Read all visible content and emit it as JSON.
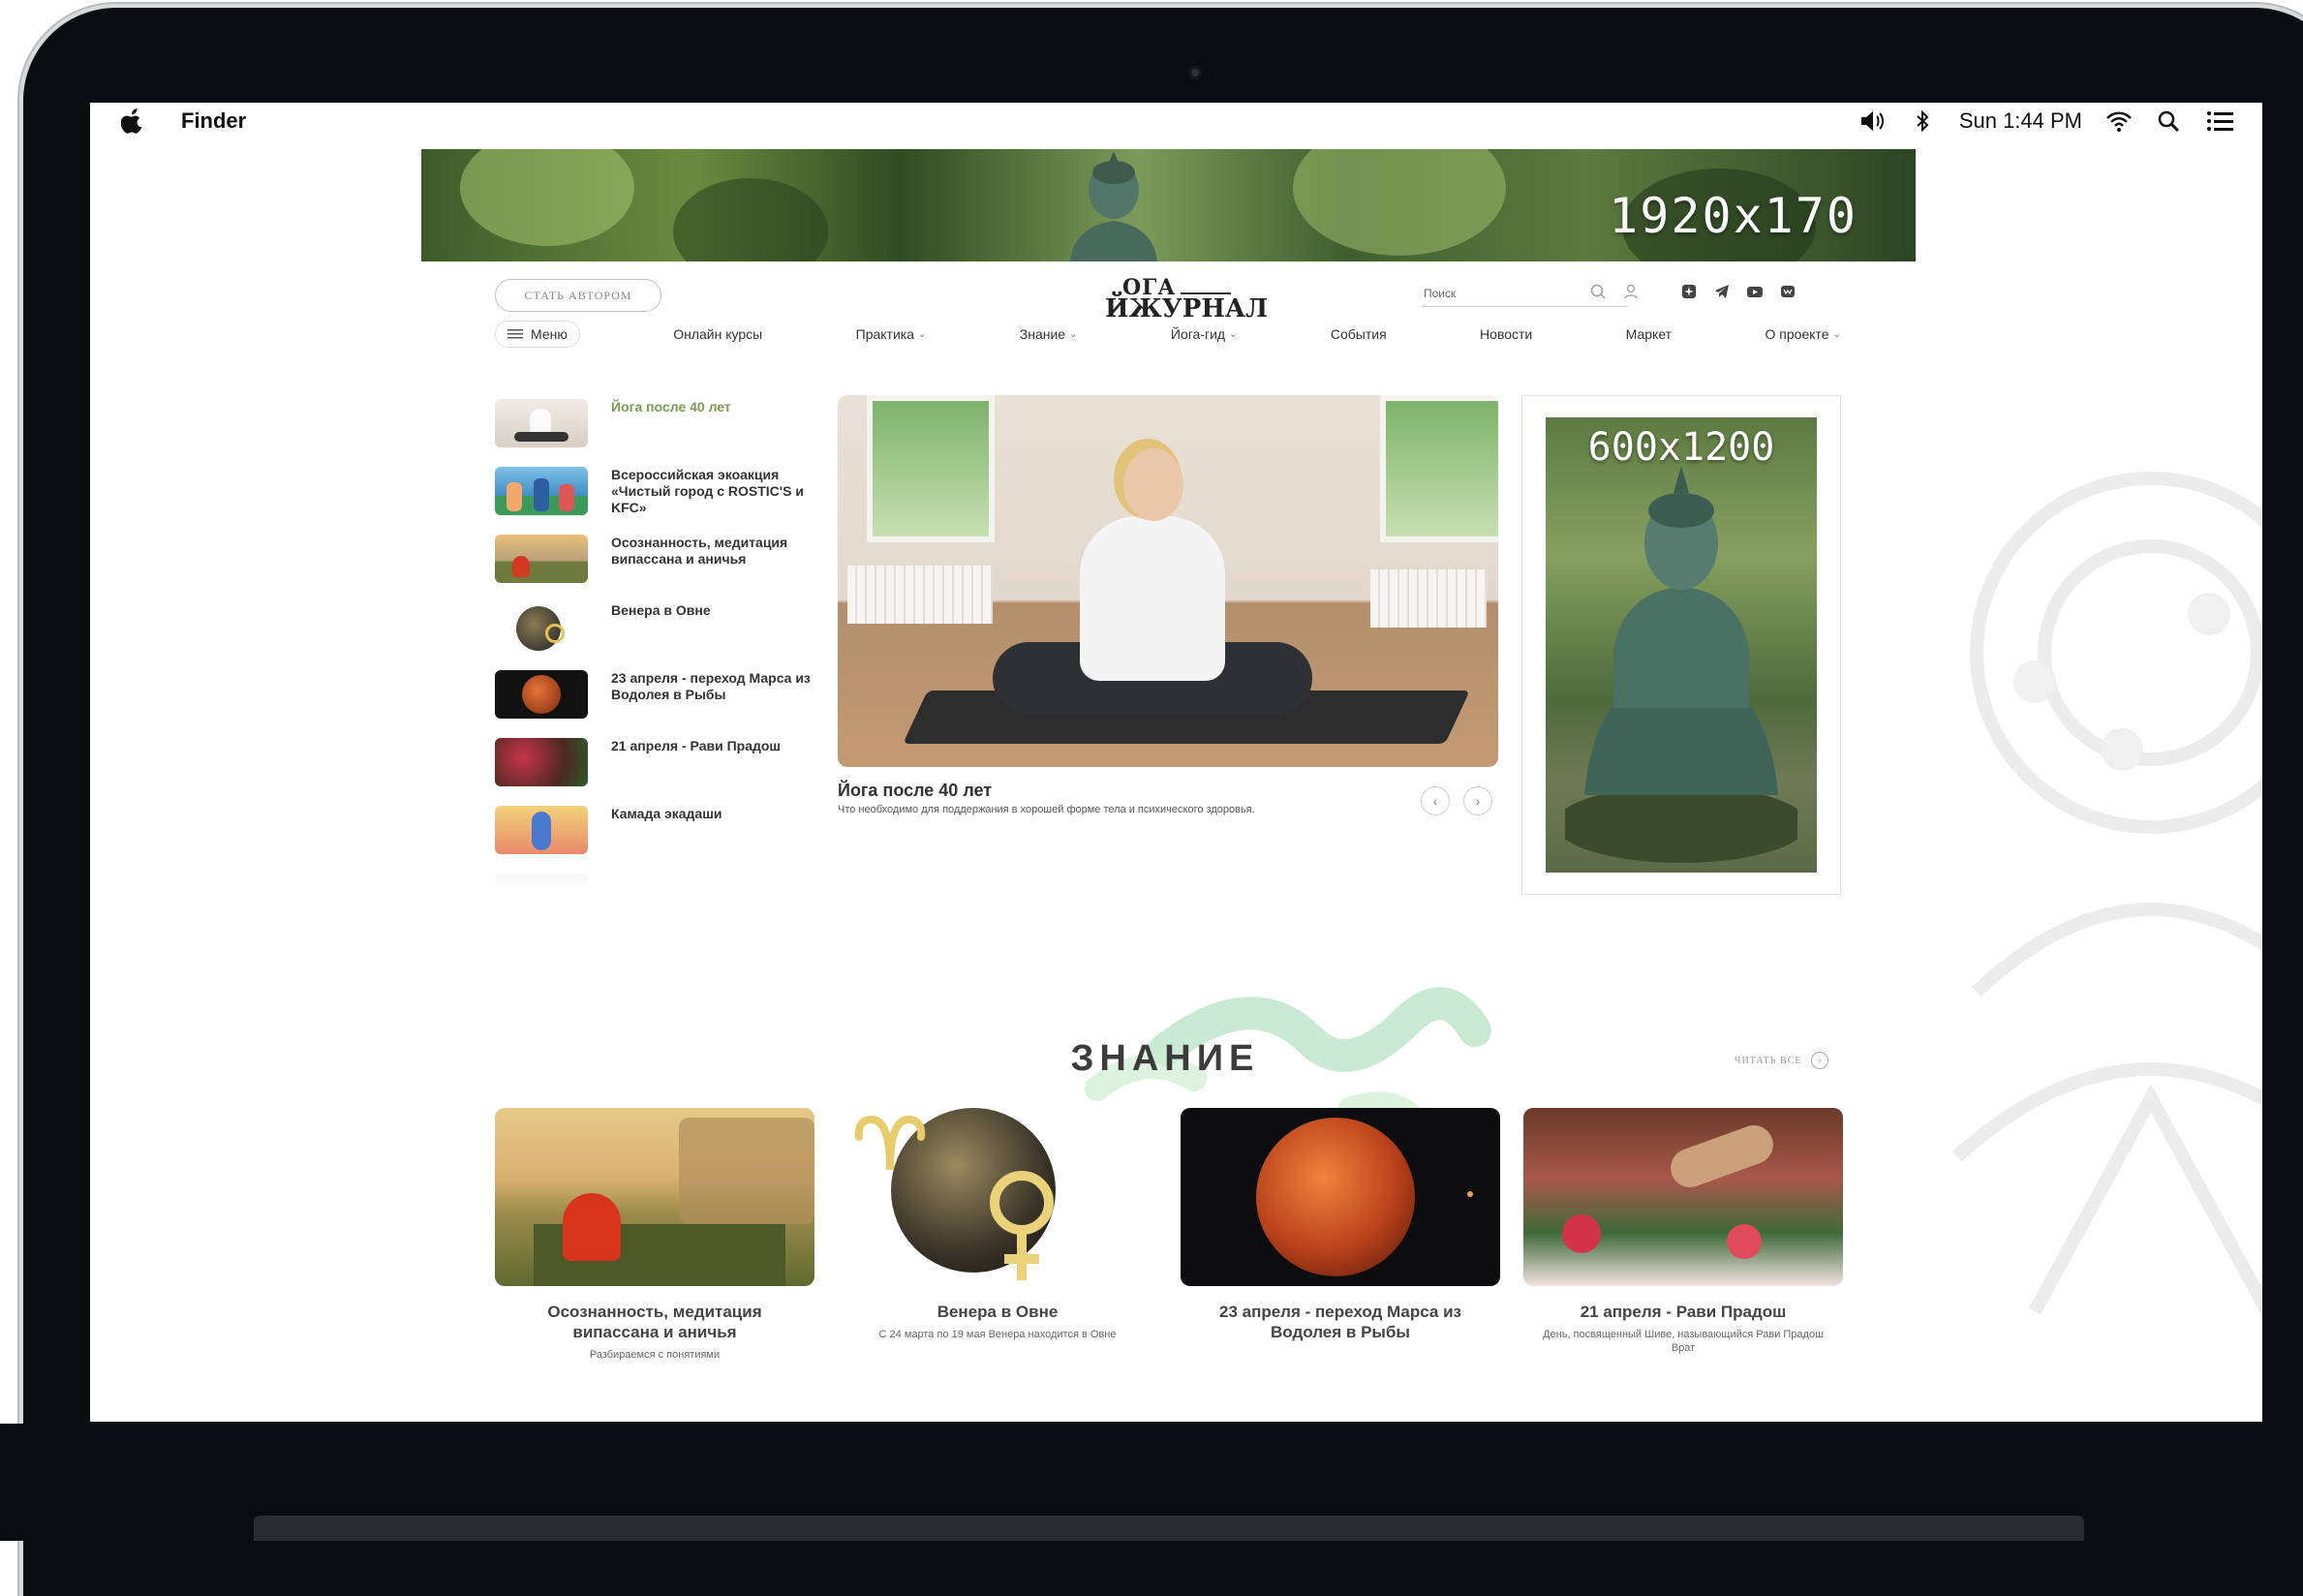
{
  "menubar": {
    "app_name": "Finder",
    "clock": "Sun 1:44 PM"
  },
  "banner": {
    "label": "1920x170"
  },
  "header": {
    "author_button": "СТАТЬ АВТОРОМ",
    "logo_top": "ОГА",
    "logo_bottom": "ЙЖУРНАЛ",
    "search_placeholder": "Поиск"
  },
  "nav": {
    "menu": "Меню",
    "items": [
      {
        "label": "Онлайн курсы"
      },
      {
        "label": "Практика"
      },
      {
        "label": "Знание"
      },
      {
        "label": "Йога-гид"
      },
      {
        "label": "События"
      },
      {
        "label": "Новости"
      },
      {
        "label": "Маркет"
      },
      {
        "label": "О проекте"
      }
    ]
  },
  "sidebar_list": [
    {
      "label": "Йога после 40 лет"
    },
    {
      "label": "Всероссийская экоакция «Чистый город с ROSTIC'S и KFC»"
    },
    {
      "label": "Осознанность, медитация випассана и аничья"
    },
    {
      "label": "Венера в Овне"
    },
    {
      "label": "23 апреля - переход Марса из Водолея в Рыбы"
    },
    {
      "label": "21 апреля - Рави Прадош"
    },
    {
      "label": "Камада экадаши"
    }
  ],
  "featured": {
    "title": "Йога после 40 лет",
    "description": "Что необходимо для поддержания в хорошей форме тела и психического здоровья."
  },
  "ad": {
    "label": "600x1200"
  },
  "knowledge": {
    "title": "ЗНАНИЕ",
    "read_all": "ЧИТАТЬ ВСЕ",
    "cards": [
      {
        "title": "Осознанность, медитация випассана и аничья",
        "description": "Разбираемся с понятиями"
      },
      {
        "title": "Венера в Овне",
        "description": "С 24 марта по 19 мая Венера находится в Овне"
      },
      {
        "title": "23 апреля - переход Марса из Водолея в Рыбы",
        "description": ""
      },
      {
        "title": "21 апреля - Рави Прадош",
        "description": "День, посвященный Шиве, называющийся Рави Прадош Врат"
      }
    ]
  }
}
